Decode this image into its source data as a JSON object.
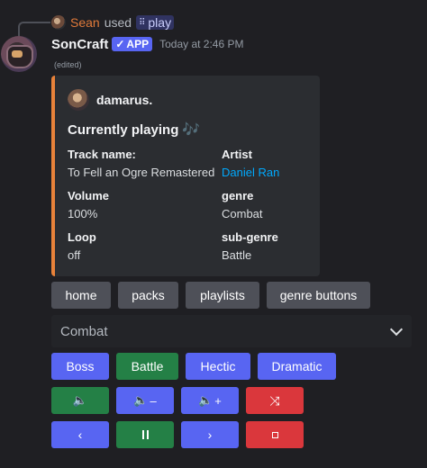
{
  "reply": {
    "user": "Sean",
    "used": "used",
    "command_icon": "⠿",
    "command": "play"
  },
  "message": {
    "bot_name": "SonCraft",
    "badge_check": "✓",
    "badge": "APP",
    "timestamp": "Today at 2:46 PM",
    "edited": "(edited)"
  },
  "embed": {
    "accent_color": "#e8823a",
    "author": "damarus.",
    "title": "Currently playing",
    "title_icon": "🎶",
    "fields": {
      "track_name_label": "Track name:",
      "track_name": "To Fell an Ogre Remastered",
      "artist_label": "Artist",
      "artist": "Daniel Ran",
      "volume_label": "Volume",
      "volume": "100%",
      "genre_label": "genre",
      "genre": "Combat",
      "loop_label": "Loop",
      "loop": "off",
      "subgenre_label": "sub-genre",
      "subgenre": "Battle"
    }
  },
  "nav_buttons": {
    "home": "home",
    "packs": "packs",
    "playlists": "playlists",
    "genre_buttons": "genre buttons"
  },
  "select": {
    "value": "Combat"
  },
  "subgenre_buttons": {
    "boss": "Boss",
    "battle": "Battle",
    "hectic": "Hectic",
    "dramatic": "Dramatic"
  },
  "controls": {
    "speaker": "🔈",
    "volume_down_sign": "–",
    "volume_up_sign": "+",
    "shuffle": "⤨",
    "previous": "‹",
    "next": "›"
  }
}
